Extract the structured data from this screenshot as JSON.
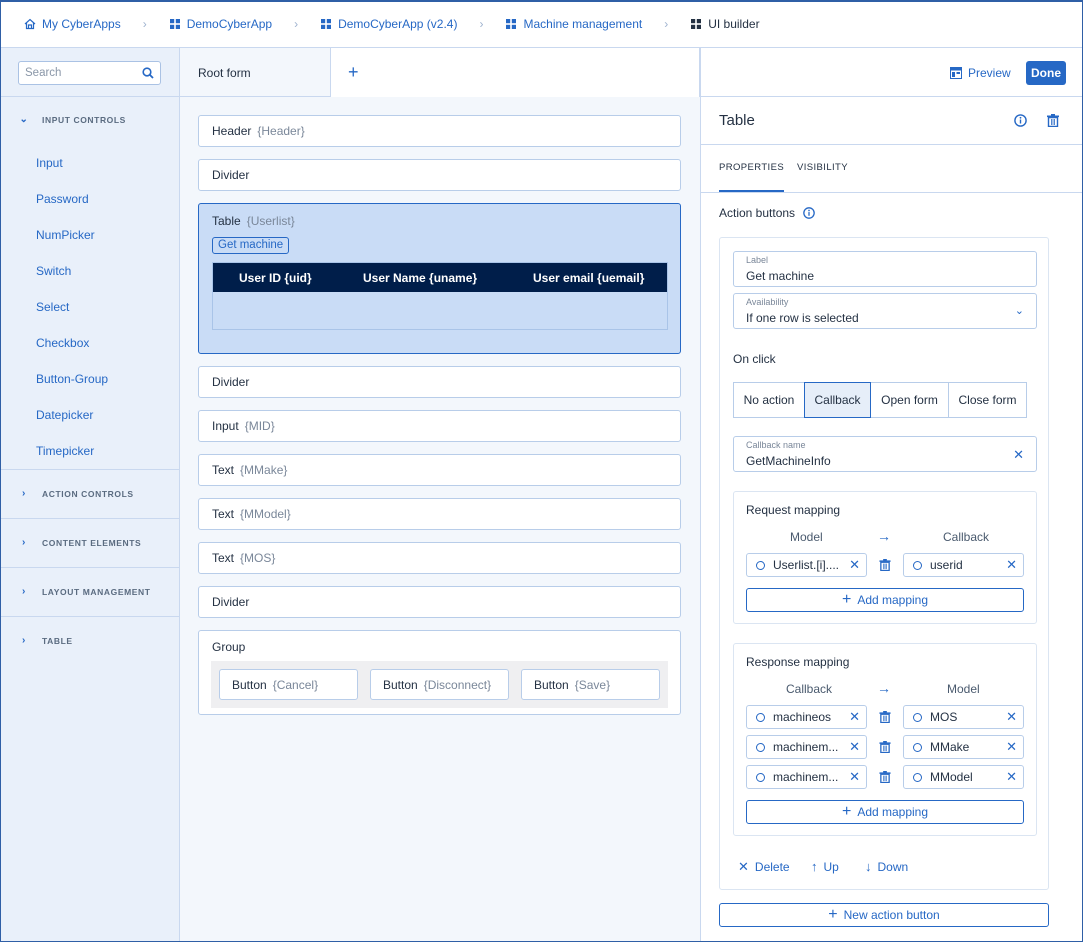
{
  "breadcrumbs": [
    {
      "label": "My CyberApps",
      "icon": "home-icon"
    },
    {
      "label": "DemoCyberApp",
      "icon": "grid-icon"
    },
    {
      "label": "DemoCyberApp (v2.4)",
      "icon": "grid-icon"
    },
    {
      "label": "Machine management",
      "icon": "grid-icon"
    },
    {
      "label": "UI builder",
      "icon": "grid-icon"
    }
  ],
  "sidebar": {
    "search_placeholder": "Search",
    "sections": [
      {
        "label": "INPUT CONTROLS",
        "expanded": true,
        "items": [
          "Input",
          "Password",
          "NumPicker",
          "Switch",
          "Select",
          "Checkbox",
          "Button-Group",
          "Datepicker",
          "Timepicker"
        ]
      },
      {
        "label": "ACTION CONTROLS",
        "expanded": false
      },
      {
        "label": "CONTENT ELEMENTS",
        "expanded": false
      },
      {
        "label": "LAYOUT MANAGEMENT",
        "expanded": false
      },
      {
        "label": "TABLE",
        "expanded": false
      }
    ]
  },
  "canvas": {
    "tab": "Root form",
    "add_tab": "+",
    "blocks": [
      {
        "type": "Header",
        "bind": "{Header}"
      },
      {
        "type": "Divider",
        "bind": ""
      },
      {
        "type": "Table",
        "bind": "{Userlist}",
        "selected": true,
        "action_button": "Get machine",
        "columns": [
          "User ID {uid}",
          "User Name {uname}",
          "User email {uemail}"
        ]
      },
      {
        "type": "Divider",
        "bind": ""
      },
      {
        "type": "Input",
        "bind": "{MID}"
      },
      {
        "type": "Text",
        "bind": "{MMake}"
      },
      {
        "type": "Text",
        "bind": "{MModel}"
      },
      {
        "type": "Text",
        "bind": "{MOS}"
      },
      {
        "type": "Divider",
        "bind": ""
      },
      {
        "type": "Group",
        "bind": "",
        "children": [
          {
            "type": "Button",
            "bind": "{Cancel}"
          },
          {
            "type": "Button",
            "bind": "{Disconnect}"
          },
          {
            "type": "Button",
            "bind": "{Save}"
          }
        ]
      }
    ]
  },
  "panel": {
    "preview_label": "Preview",
    "done_label": "Done",
    "title": "Table",
    "tabs": [
      {
        "label": "PROPERTIES",
        "active": true
      },
      {
        "label": "VISIBILITY",
        "active": false
      }
    ],
    "action_buttons_label": "Action buttons",
    "label_field": {
      "label": "Label",
      "value": "Get machine"
    },
    "availability_field": {
      "label": "Availability",
      "value": "If one row is selected"
    },
    "on_click_label": "On click",
    "on_click_options": [
      {
        "label": "No action",
        "selected": false
      },
      {
        "label": "Callback",
        "selected": true
      },
      {
        "label": "Open form",
        "selected": false
      },
      {
        "label": "Close form",
        "selected": false
      }
    ],
    "callback_field": {
      "label": "Callback name",
      "value": "GetMachineInfo"
    },
    "request_mapping": {
      "title": "Request mapping",
      "left_header": "Model",
      "right_header": "Callback",
      "rows": [
        {
          "left": "Userlist.[i]....",
          "right": "userid"
        }
      ],
      "add_label": "Add mapping"
    },
    "response_mapping": {
      "title": "Response mapping",
      "left_header": "Callback",
      "right_header": "Model",
      "rows": [
        {
          "left": "machineos",
          "right": "MOS"
        },
        {
          "left": "machinem...",
          "right": "MMake"
        },
        {
          "left": "machinem...",
          "right": "MModel"
        }
      ],
      "add_label": "Add mapping"
    },
    "actions": {
      "delete": "Delete",
      "up": "Up",
      "down": "Down"
    },
    "new_action_button": "New action button"
  },
  "colors": {
    "accent": "#2668c5",
    "table_header": "#001e4a",
    "selected_block": "#c9dcf6",
    "sidebar_bg": "#e9f0fa"
  }
}
